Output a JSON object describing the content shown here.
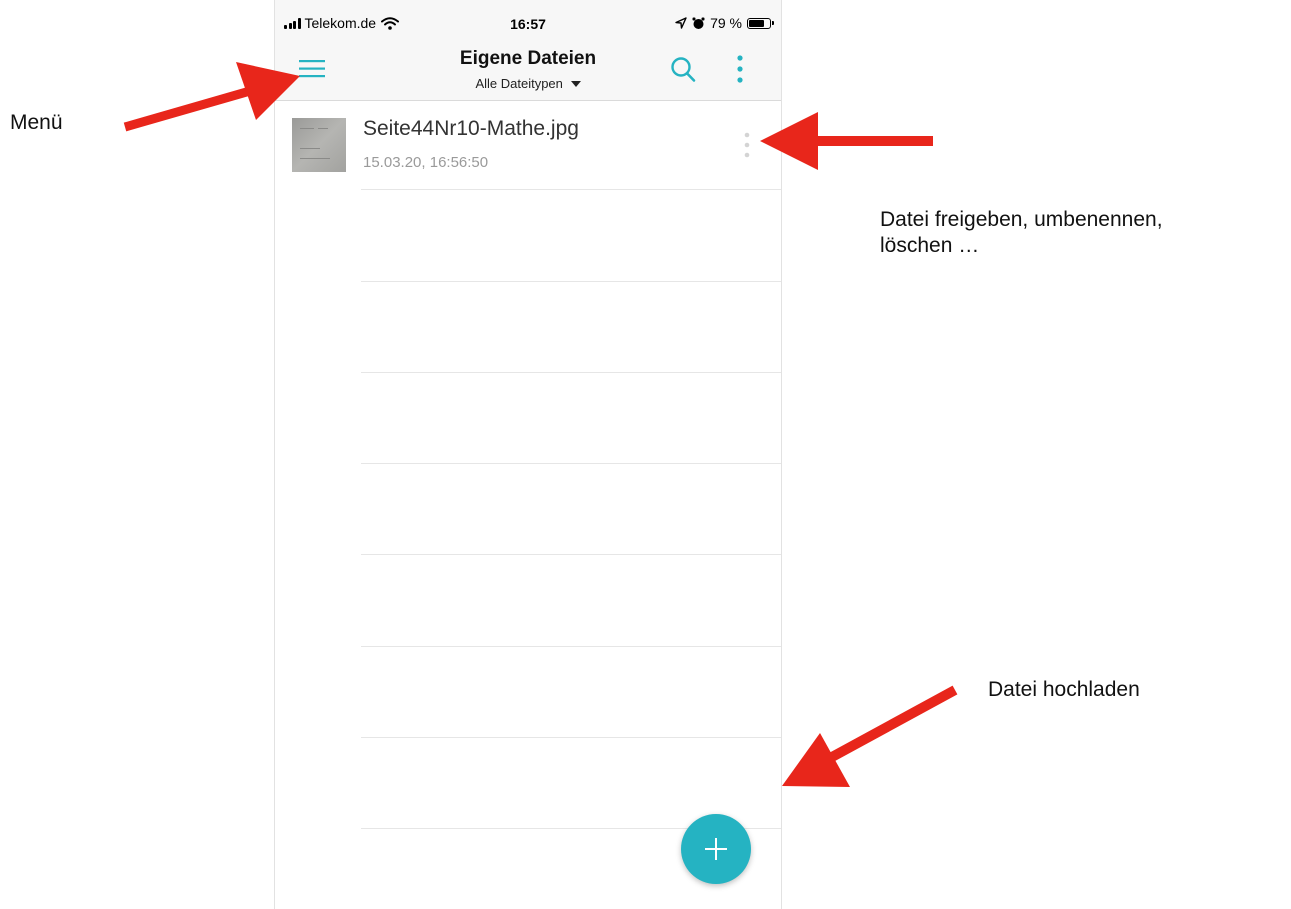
{
  "annotations": {
    "menu": "Menü",
    "file_actions_line1": "Datei freigeben, umbenennen,",
    "file_actions_line2": "löschen …",
    "upload": "Datei hochladen"
  },
  "statusbar": {
    "carrier": "Telekom.de",
    "time": "16:57",
    "battery": "79 %",
    "battery_level": 0.79
  },
  "header": {
    "title": "Eigene Dateien",
    "filter_label": "Alle Dateitypen",
    "icons": [
      "menu-icon",
      "search-icon",
      "more-vertical-icon"
    ]
  },
  "files": [
    {
      "name": "Seite44Nr10-Mathe.jpg",
      "date": "15.03.20, 16:56:50"
    }
  ],
  "colors": {
    "accent": "#25b3c2",
    "arrow": "#e8261b"
  }
}
